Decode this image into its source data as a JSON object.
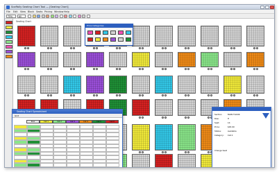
{
  "window": {
    "title": "Scaffolly Seating Chart Tool — [Seating Chart]",
    "controls": [
      "minimize-icon",
      "maximize-icon",
      "close-icon"
    ]
  },
  "menu": [
    "File",
    "Edit",
    "View",
    "Block",
    "Seats",
    "Pricing",
    "Window",
    "Help"
  ],
  "toolbar": {
    "zoom_value": "75%",
    "section_value": "All",
    "buttons": [
      "new-icon",
      "open-icon",
      "save-icon",
      "print-icon",
      "undo-icon",
      "redo-icon",
      "zoom-in-icon",
      "zoom-out-icon",
      "select-icon",
      "move-icon",
      "grid-icon",
      "color-icon",
      "settings-icon",
      "help-icon"
    ]
  },
  "canvas": {
    "tab_label": "Seating Chart"
  },
  "palette": {
    "title": "Price Categories"
  },
  "sheet": {
    "title": "Seating Chart Spreadsheet",
    "toolbar_label": "Grid",
    "columns": [
      "Row",
      "Cat 1",
      "Cat 2",
      "Cat 3",
      "Cat 4",
      "Cat 5",
      "Cat 6"
    ]
  },
  "info": {
    "fields": [
      {
        "label": "Section:",
        "value": "MAIN FLOOR"
      },
      {
        "label": "Row:",
        "value": "H"
      },
      {
        "label": "Seat:",
        "value": "14"
      },
      {
        "label": "Price:",
        "value": "$45.00"
      },
      {
        "label": "Status:",
        "value": "Available"
      },
      {
        "label": "Category:",
        "value": "Cat 2"
      }
    ],
    "footer_label": "Change Seat"
  },
  "colors": {
    "accent": "#2d5fbf",
    "red": "#d52121",
    "purple": "#9a4fd8",
    "green": "#1f8f36",
    "lightgreen": "#8ae68a",
    "yellow": "#f1ea3a",
    "orange": "#f08b17",
    "cyan": "#33c8e8",
    "pink": "#f04fb2",
    "gray": "#d4d4d4"
  }
}
